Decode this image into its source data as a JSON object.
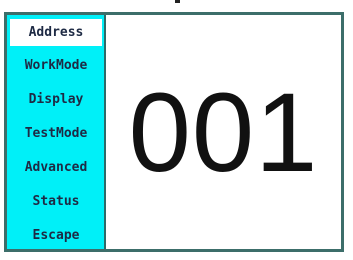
{
  "menu": {
    "items": [
      {
        "label": "Address"
      },
      {
        "label": "WorkMode"
      },
      {
        "label": "Display"
      },
      {
        "label": "TestMode"
      },
      {
        "label": "Advanced"
      },
      {
        "label": "Status"
      },
      {
        "label": "Escape"
      }
    ],
    "selected_index": 0
  },
  "display": {
    "value": "001"
  },
  "colors": {
    "sidebar_bg": "#00f0f8",
    "selected_bg": "#ffffff",
    "frame_border": "#3c6e6a",
    "menu_text": "#1e2a44"
  }
}
